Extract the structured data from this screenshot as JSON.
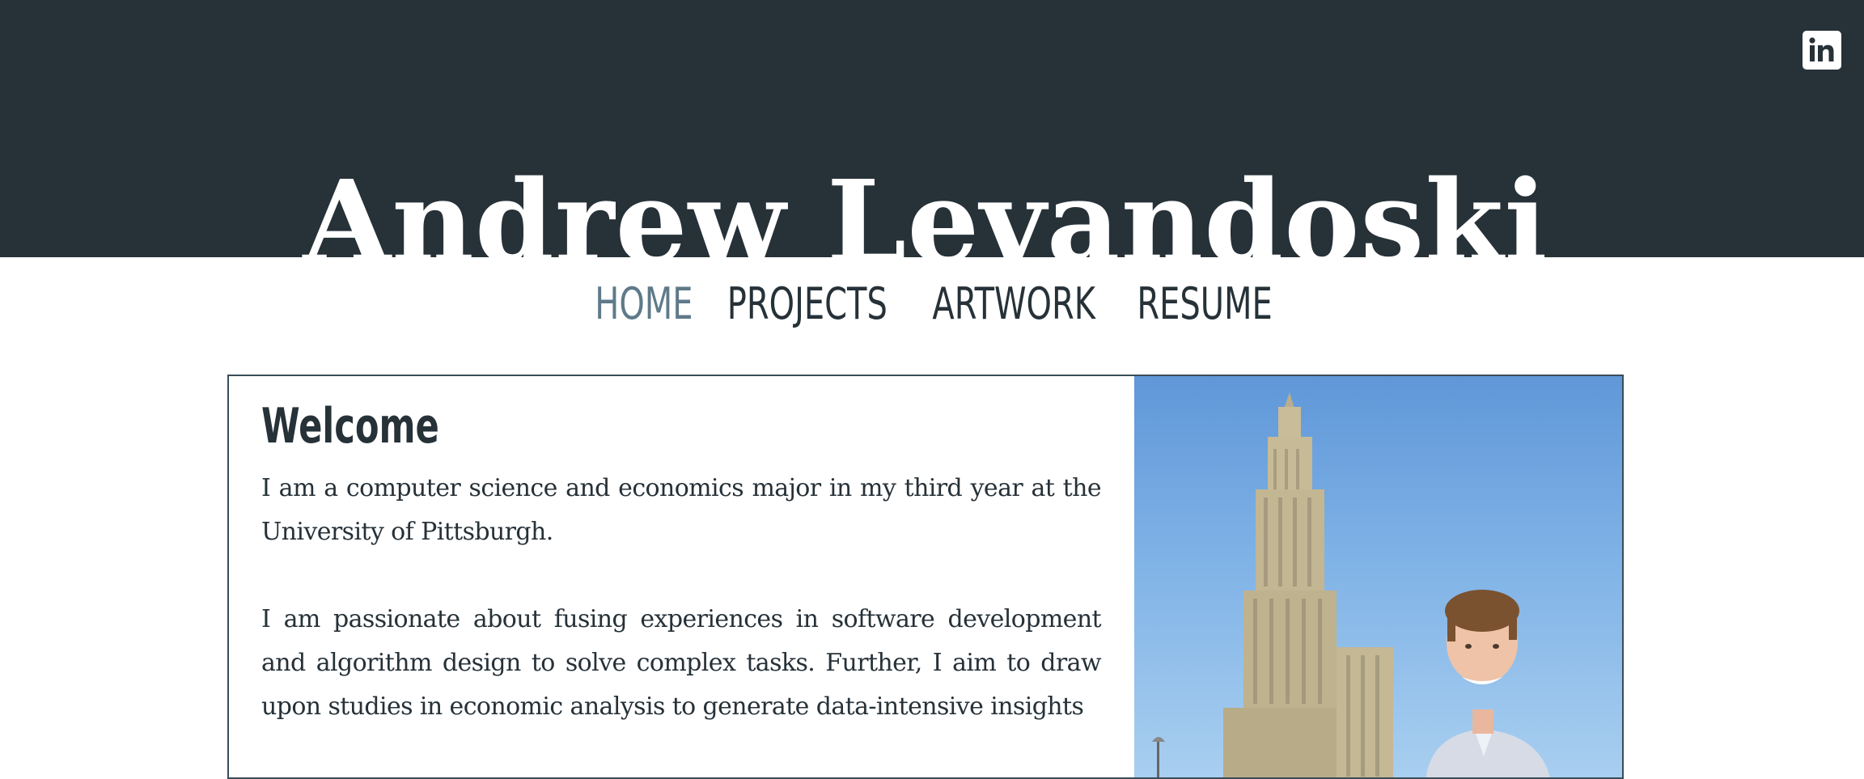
{
  "header": {
    "site_title": "Andrew Levandoski",
    "social_icon": "linkedin-icon",
    "background_color": "#263138"
  },
  "nav": {
    "items": [
      {
        "label": "HOME",
        "active": true
      },
      {
        "label": "PROJECTS",
        "active": false
      },
      {
        "label": "ARTWORK",
        "active": false
      },
      {
        "label": "RESUME",
        "active": false
      }
    ],
    "active_color": "#5f7a89",
    "color": "#263138"
  },
  "main": {
    "heading": "Welcome",
    "paragraphs": [
      "I am a computer science and economics major in my third year at the University of Pittsburgh.",
      "I am passionate about fusing experiences in software development and algorithm design to solve complex tasks. Further, I aim to draw upon studies in economic analysis to generate data-intensive insights"
    ]
  }
}
